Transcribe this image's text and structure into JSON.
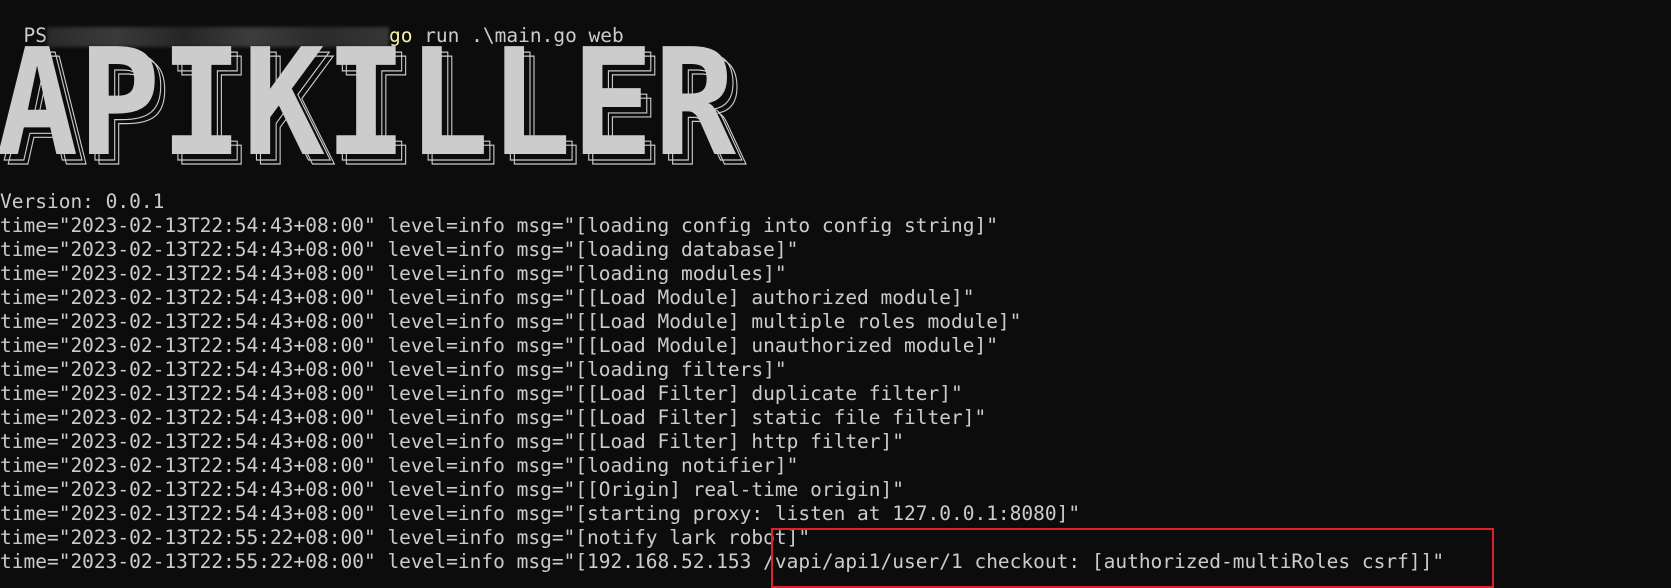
{
  "command": {
    "prompt_prefix": "PS",
    "go_keyword": "go",
    "args": " run .\\main.go web"
  },
  "banner_text": "APIKILLER",
  "version_line": "Version: 0.0.1",
  "logs": [
    {
      "time": "time=\"2023-02-13T22:54:43+08:00\"",
      "level": "level=info",
      "msg": "msg=\"[loading config into config string]\""
    },
    {
      "time": "time=\"2023-02-13T22:54:43+08:00\"",
      "level": "level=info",
      "msg": "msg=\"[loading database]\""
    },
    {
      "time": "time=\"2023-02-13T22:54:43+08:00\"",
      "level": "level=info",
      "msg": "msg=\"[loading modules]\""
    },
    {
      "time": "time=\"2023-02-13T22:54:43+08:00\"",
      "level": "level=info",
      "msg": "msg=\"[[Load Module] authorized module]\""
    },
    {
      "time": "time=\"2023-02-13T22:54:43+08:00\"",
      "level": "level=info",
      "msg": "msg=\"[[Load Module] multiple roles module]\""
    },
    {
      "time": "time=\"2023-02-13T22:54:43+08:00\"",
      "level": "level=info",
      "msg": "msg=\"[[Load Module] unauthorized module]\""
    },
    {
      "time": "time=\"2023-02-13T22:54:43+08:00\"",
      "level": "level=info",
      "msg": "msg=\"[loading filters]\""
    },
    {
      "time": "time=\"2023-02-13T22:54:43+08:00\"",
      "level": "level=info",
      "msg": "msg=\"[[Load Filter] duplicate filter]\""
    },
    {
      "time": "time=\"2023-02-13T22:54:43+08:00\"",
      "level": "level=info",
      "msg": "msg=\"[[Load Filter] static file filter]\""
    },
    {
      "time": "time=\"2023-02-13T22:54:43+08:00\"",
      "level": "level=info",
      "msg": "msg=\"[[Load Filter] http filter]\""
    },
    {
      "time": "time=\"2023-02-13T22:54:43+08:00\"",
      "level": "level=info",
      "msg": "msg=\"[loading notifier]\""
    },
    {
      "time": "time=\"2023-02-13T22:54:43+08:00\"",
      "level": "level=info",
      "msg": "msg=\"[[Origin] real-time origin]\""
    },
    {
      "time": "time=\"2023-02-13T22:54:43+08:00\"",
      "level": "level=info",
      "msg": "msg=\"[starting proxy: listen at 127.0.0.1:8080]\""
    },
    {
      "time": "time=\"2023-02-13T22:55:22+08:00\"",
      "level": "level=info",
      "msg": "msg=\"[notify lark robot]\""
    },
    {
      "time": "time=\"2023-02-13T22:55:22+08:00\"",
      "level": "level=info",
      "msg": "msg=\"[192.168.52.153 /vapi/api1/user/1 checkout: [authorized-multiRoles csrf]]\""
    }
  ],
  "colors": {
    "background": "#0c0c0c",
    "text": "#cccccc",
    "go_keyword": "#f9f1a5",
    "highlight_box": "#e0202a"
  }
}
